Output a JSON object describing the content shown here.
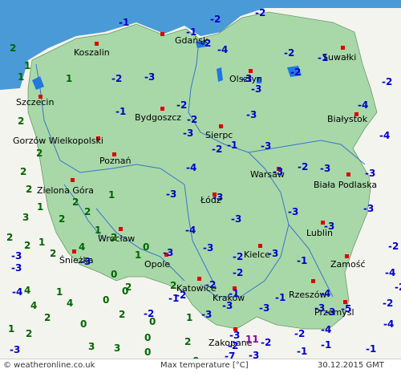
{
  "map": {
    "colors": {
      "background": "#f4f4ee",
      "poland_fill": "#a8d8a8",
      "sea": "#4a9ad8",
      "lakes": "#1f78e0",
      "negative": "#0000cc",
      "positive": "#006600",
      "city_dot": "#e00000"
    },
    "cities": [
      {
        "name": "Gdańsk"
      },
      {
        "name": "Koszalin"
      },
      {
        "name": "Suwałki"
      },
      {
        "name": "Olsztyn"
      },
      {
        "name": "Szczecin"
      },
      {
        "name": "Bydgoszcz"
      },
      {
        "name": "Białystok"
      },
      {
        "name": "Sierpc"
      },
      {
        "name": "Gorzów Wielkopolski"
      },
      {
        "name": "Poznań"
      },
      {
        "name": "Warsaw"
      },
      {
        "name": "Biała Podlaska"
      },
      {
        "name": "Zielona Góra"
      },
      {
        "name": "Łódź"
      },
      {
        "name": "Lublin"
      },
      {
        "name": "Wrocław"
      },
      {
        "name": "Opole"
      },
      {
        "name": "Kielce"
      },
      {
        "name": "Zamość"
      },
      {
        "name": "Śnieżka"
      },
      {
        "name": "Katowice"
      },
      {
        "name": "Kraków"
      },
      {
        "name": "Rzeszów"
      },
      {
        "name": "Przemyśl"
      },
      {
        "name": "Zakopane"
      }
    ],
    "temperatures": [
      "-2",
      "-1",
      "-2",
      "-1",
      "-2",
      "-2",
      "-1",
      "-4",
      "-2",
      "-3",
      "-2",
      "-2",
      "-3",
      "-2",
      "-3",
      "-4",
      "-1",
      "-2",
      "-3",
      "-3",
      "-4",
      "-2",
      "-1",
      "-3",
      "-2",
      "-3",
      "-3",
      "-4",
      "-3",
      "-3",
      "-3",
      "-3",
      "-3",
      "-3",
      "-4",
      "-3",
      "-2",
      "-2",
      "-3",
      "-3",
      "-3",
      "-3",
      "-3",
      "-3",
      "-4",
      "-1",
      "-4",
      "-2",
      "-2",
      "-2",
      "-1",
      "-1",
      "-4",
      "-2",
      "-3",
      "-3",
      "-3",
      "-3",
      "-3",
      "-5",
      "-4",
      "-2",
      "-7",
      "-3",
      "-1",
      "-3",
      "-2",
      "-2",
      "-1",
      "-2",
      "-1",
      "-1",
      "-4",
      "-3",
      "-2"
    ],
    "temperatures_positive": [
      "2",
      "1",
      "1",
      "1",
      "2",
      "2",
      "2",
      "2",
      "1",
      "2",
      "2",
      "2",
      "1",
      "1",
      "2",
      "2",
      "4",
      "2",
      "4",
      "1",
      "4",
      "4",
      "2",
      "2",
      "0",
      "0",
      "0",
      "0",
      "0",
      "1",
      "2",
      "3",
      "3",
      "0",
      "0",
      "2",
      "1",
      "2",
      "0",
      "2",
      "2",
      "1",
      "0",
      "3",
      "1"
    ],
    "special_marker": "11"
  },
  "footer": {
    "source": "© weatheronline.co.uk",
    "title": "Max temperature [°C]",
    "timestamp": "30.12.2015 GMT"
  }
}
